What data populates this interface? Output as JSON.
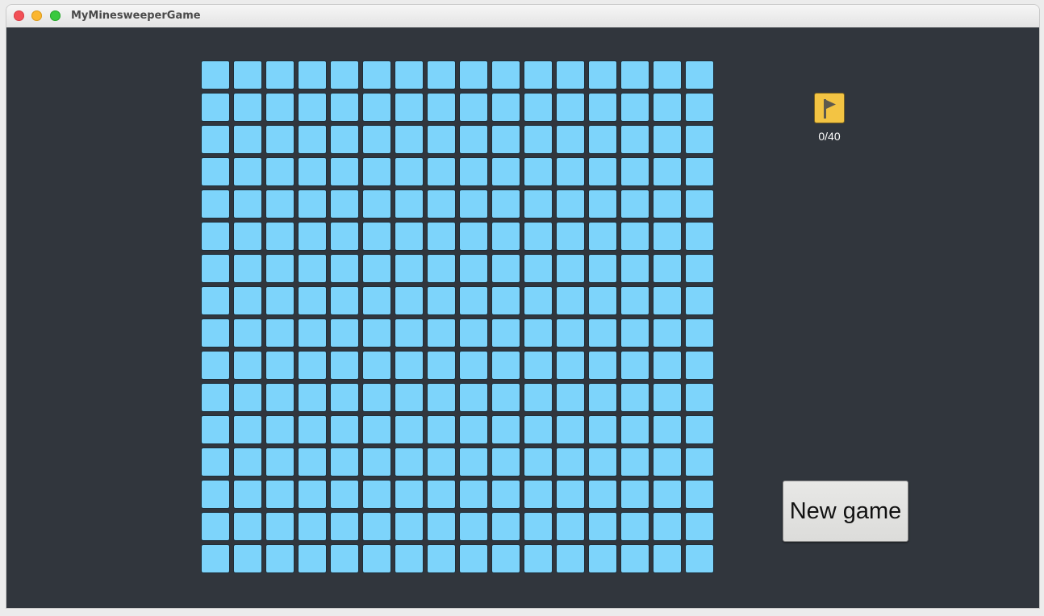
{
  "window": {
    "title": "MyMinesweeperGame"
  },
  "board": {
    "rows": 16,
    "cols": 16,
    "cell_state": "covered",
    "cell_color": "#7dd4fb"
  },
  "flags": {
    "icon": "flag-icon",
    "counter": "0/40",
    "tile_color": "#f3c443"
  },
  "controls": {
    "new_game_label": "New game"
  },
  "colors": {
    "background": "#31363d"
  }
}
